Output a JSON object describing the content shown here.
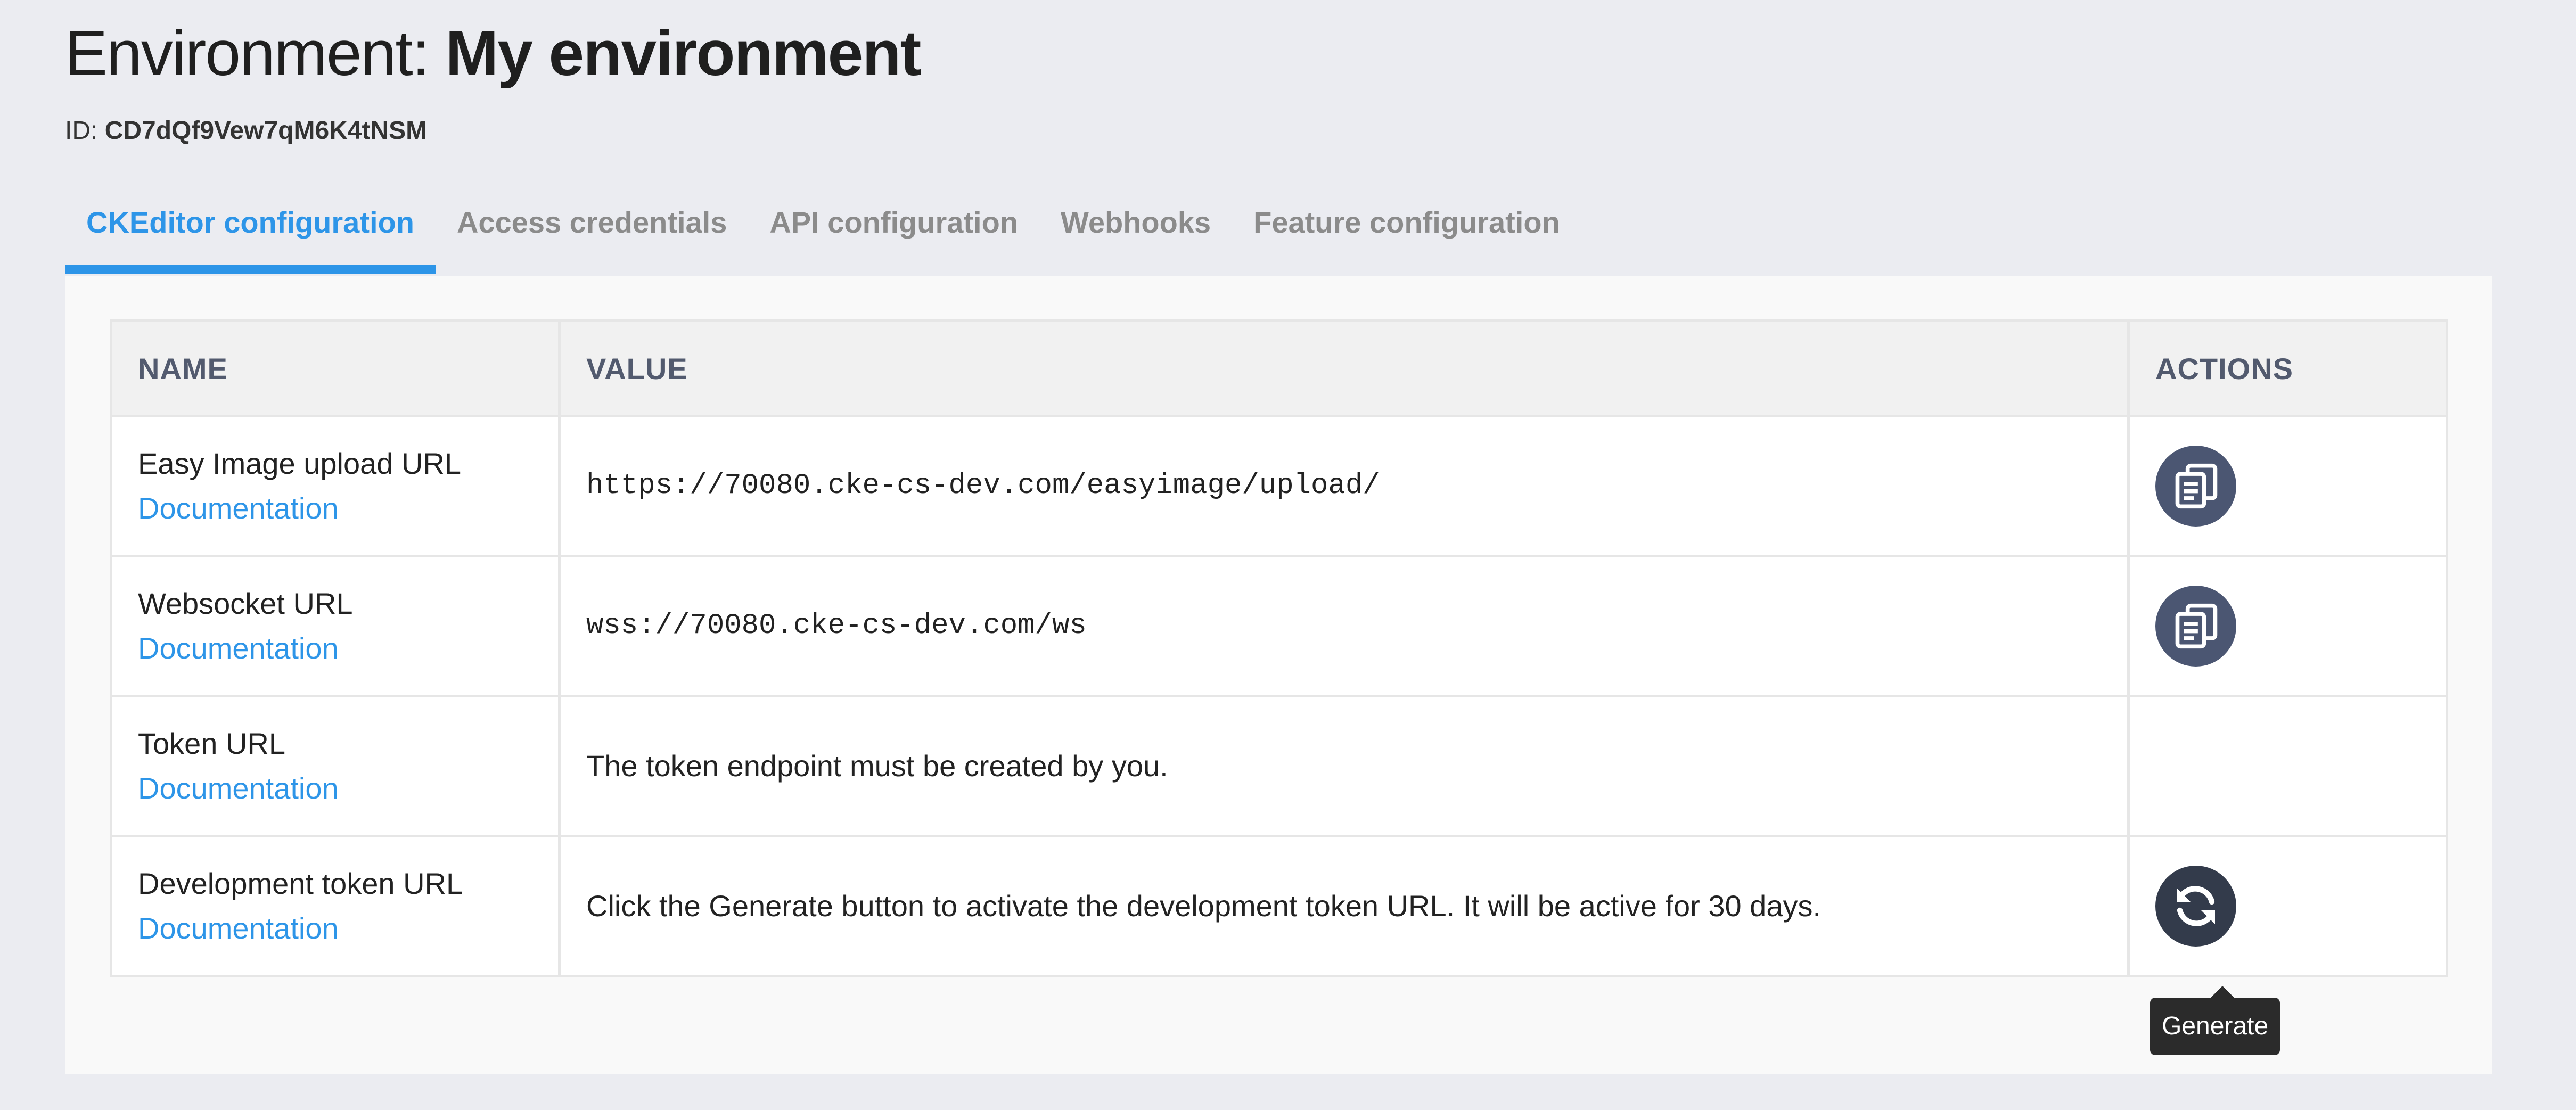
{
  "header": {
    "title_prefix": "Environment:",
    "title_name": "My environment",
    "id_label": "ID:",
    "id_value": "CD7dQf9Vew7qM6K4tNSM"
  },
  "tabs": [
    {
      "label": "CKEditor configuration",
      "active": true
    },
    {
      "label": "Access credentials",
      "active": false
    },
    {
      "label": "API configuration",
      "active": false
    },
    {
      "label": "Webhooks",
      "active": false
    },
    {
      "label": "Feature configuration",
      "active": false
    }
  ],
  "table": {
    "headers": {
      "name": "NAME",
      "value": "VALUE",
      "actions": "ACTIONS"
    },
    "rows": [
      {
        "name": "Easy Image upload URL",
        "doc": "Documentation",
        "value": "https://70080.cke-cs-dev.com/easyimage/upload/",
        "action": "copy-icon"
      },
      {
        "name": "Websocket URL",
        "doc": "Documentation",
        "value": "wss://70080.cke-cs-dev.com/ws",
        "action": "copy-icon"
      },
      {
        "name": "Token URL",
        "doc": "Documentation",
        "value": "The token endpoint must be created by you.",
        "action": ""
      },
      {
        "name": "Development token URL",
        "doc": "Documentation",
        "value": "Click the Generate button to activate the development token URL. It will be active for 30 days.",
        "action": "refresh-icon"
      }
    ]
  },
  "tooltip": {
    "generate": "Generate"
  },
  "colors": {
    "accent": "#2d95e8",
    "background": "#ebecf1",
    "action_button": "#4b5672"
  }
}
